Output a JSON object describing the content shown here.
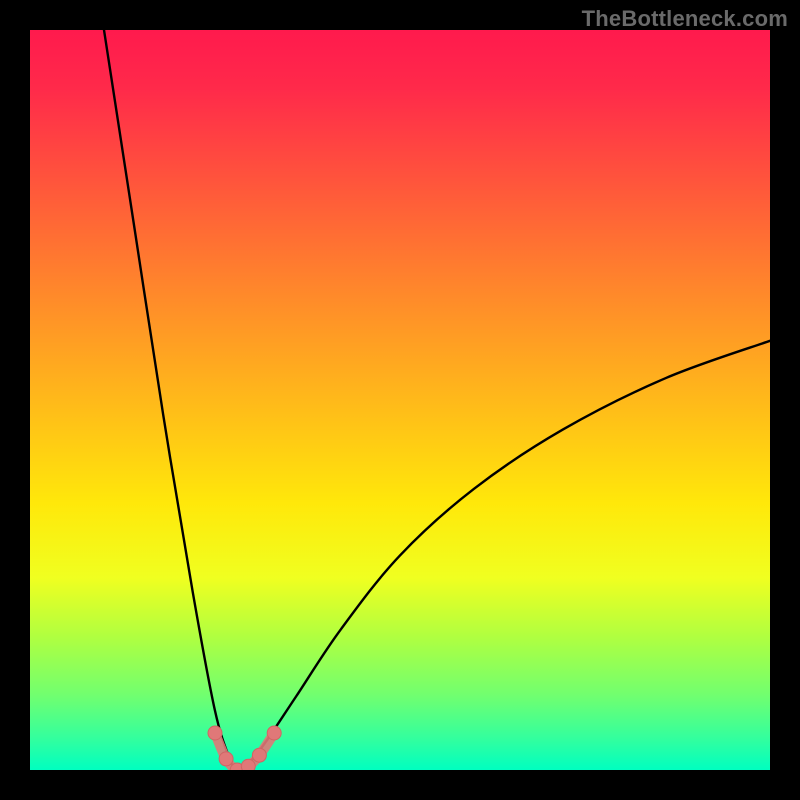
{
  "watermark": "TheBottleneck.com",
  "colors": {
    "gradient_top": "#ff1a4d",
    "gradient_bottom": "#00ffc0",
    "curve": "#000000",
    "markers": "#e07878",
    "frame": "#000000"
  },
  "chart_data": {
    "type": "line",
    "title": "",
    "xlabel": "",
    "ylabel": "",
    "xlim": [
      0,
      100
    ],
    "ylim": [
      0,
      100
    ],
    "notes": "V-shaped bottleneck curve. Minimum near x≈28 at y≈0. Left branch rises steeply to ~100 at x≈10; right branch rises concavely to ~58 at x=100. Pink markers cluster near the trough (x≈25–33, y≈0–5).",
    "series": [
      {
        "name": "bottleneck-curve",
        "x": [
          10,
          14,
          18,
          22,
          25,
          27,
          28,
          29,
          30,
          32,
          36,
          42,
          50,
          60,
          72,
          86,
          100
        ],
        "y": [
          100,
          74,
          48,
          24,
          8,
          1.5,
          0,
          0.5,
          1.4,
          4,
          10,
          19,
          29,
          38,
          46,
          53,
          58
        ]
      }
    ],
    "markers": [
      {
        "x": 25,
        "y": 5
      },
      {
        "x": 26.5,
        "y": 1.5
      },
      {
        "x": 28,
        "y": 0
      },
      {
        "x": 29.5,
        "y": 0.5
      },
      {
        "x": 31,
        "y": 2
      },
      {
        "x": 33,
        "y": 5
      }
    ]
  }
}
